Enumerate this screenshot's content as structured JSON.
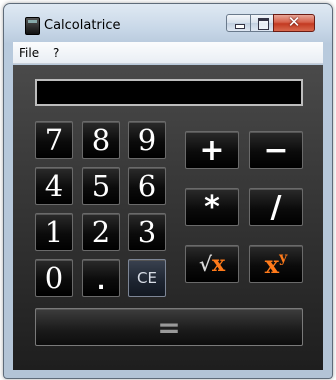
{
  "window": {
    "title": "Calcolatrice",
    "controls": {
      "minimize": "",
      "maximize": "",
      "close": "✕"
    }
  },
  "menu": {
    "items": [
      "File",
      "?"
    ]
  },
  "display": {
    "value": ""
  },
  "keypad": {
    "digits": [
      "7",
      "8",
      "9",
      "4",
      "5",
      "6",
      "1",
      "2",
      "3",
      "0"
    ],
    "dot": ".",
    "clear": "CE",
    "operators": {
      "add": "+",
      "subtract": "−",
      "multiply": "*",
      "divide": "/"
    },
    "sqrt": {
      "radical": "√",
      "operand": "x"
    },
    "power": {
      "base": "x",
      "exponent": "y"
    },
    "equals": "="
  },
  "colors": {
    "accent_orange": "#ff7a1a",
    "key_background": "#000000",
    "panel_background": "#3c3c3c"
  }
}
